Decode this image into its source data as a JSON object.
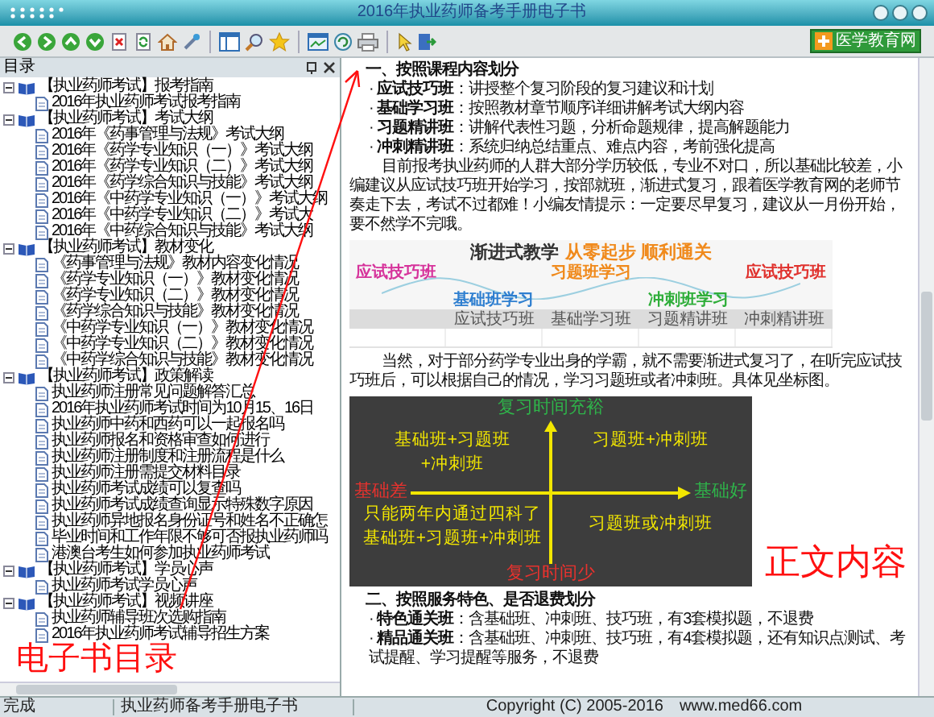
{
  "window": {
    "title": "2016年执业药师备考手册电子书"
  },
  "toolbar": {
    "logo": "医学教育网"
  },
  "sidebar": {
    "title": "目录",
    "tree": [
      {
        "label": "【执业药师考试】报考指南",
        "expanded": true,
        "children": [
          {
            "label": "2016年执业药师考试报考指南"
          }
        ]
      },
      {
        "label": "【执业药师考试】考试大纲",
        "expanded": true,
        "children": [
          {
            "label": "2016年《药事管理与法规》考试大纲"
          },
          {
            "label": "2016年《药学专业知识（一）》考试大纲"
          },
          {
            "label": "2016年《药学专业知识（二）》考试大纲"
          },
          {
            "label": "2016年《药学综合知识与技能》考试大纲"
          },
          {
            "label": "2016年《中药学专业知识（一）》考试大纲"
          },
          {
            "label": "2016年《中药学专业知识（二）》考试大"
          },
          {
            "label": "2016年《中药综合知识与技能》考试大纲"
          }
        ]
      },
      {
        "label": "【执业药师考试】教材变化",
        "expanded": true,
        "children": [
          {
            "label": "《药事管理与法规》教材内容变化情况"
          },
          {
            "label": "《药学专业知识（一）》教材变化情况"
          },
          {
            "label": "《药学专业知识（二）》教材变化情况"
          },
          {
            "label": "《药学综合知识与技能》教材变化情况"
          },
          {
            "label": "《中药学专业知识（一）》教材变化情况"
          },
          {
            "label": "《中药学专业知识（二）》教材变化情况"
          },
          {
            "label": "《中药学综合知识与技能》教材变化情况"
          }
        ]
      },
      {
        "label": "【执业药师考试】政策解读",
        "expanded": true,
        "children": [
          {
            "label": "执业药师注册常见问题解答汇总"
          },
          {
            "label": "2016年执业药师考试时间为10月15、16日"
          },
          {
            "label": "执业药师中药和西药可以一起报名吗"
          },
          {
            "label": "执业药师报名和资格审查如何进行"
          },
          {
            "label": "执业药师注册制度和注册流程是什么"
          },
          {
            "label": "执业药师注册需提交材料目录"
          },
          {
            "label": "执业药师考试成绩可以复查吗"
          },
          {
            "label": "执业药师考试成绩查询显示特殊数字原因"
          },
          {
            "label": "执业药师异地报名身份证号和姓名不正确怎"
          },
          {
            "label": "毕业时间和工作年限不够可否报执业药师吗"
          },
          {
            "label": "港澳台考生如何参加执业药师考试"
          }
        ]
      },
      {
        "label": "【执业药师考试】学员心声",
        "expanded": true,
        "children": [
          {
            "label": "执业药师考试学员心声"
          }
        ]
      },
      {
        "label": "【执业药师考试】视频讲座",
        "expanded": true,
        "children": [
          {
            "label": "执业药师辅导班次选购指南"
          },
          {
            "label": "2016年执业药师考试辅导招生方案"
          }
        ]
      }
    ],
    "annotation": "电子书目录"
  },
  "content": {
    "section_1": {
      "heading": "一、按照课程内容划分",
      "items": [
        "· **应试技巧班**：讲授整个复习阶段的复习建议和计划",
        "· **基础学习班**：按照教材章节顺序详细讲解考试大纲内容",
        "· **习题精讲班**：讲解代表性习题，分析命题规律，提高解题能力",
        "· **冲刺精讲班**：系统归纳总结重点、难点内容，考前强化提高"
      ]
    },
    "paragraph_1": "目前报考执业药师的人群大部分学历较低，专业不对口，所以基础比较差，小编建议从应试技巧班开始学习，按部就班，渐进式复习，跟着医学教育网的老师节奏走下去，考试不过都难！小编友情提示：一定要尽早复习，建议从一月份开始，要不然学不完哦。",
    "infographic": {
      "title": "渐进式教学",
      "tagline": "从零起步 顺利通关",
      "stages": [
        {
          "label": "应试技巧班",
          "color": "#d6339b"
        },
        {
          "label": "基础班学习",
          "color": "#2f7fd0"
        },
        {
          "label": "习题班学习",
          "color": "#f08a1c"
        },
        {
          "label": "冲刺班学习",
          "color": "#2fae3a"
        },
        {
          "label": "应试技巧班",
          "color": "#e0322e"
        }
      ],
      "table_headers": [
        "应试技巧班",
        "基础学习班",
        "习题精讲班",
        "冲刺精讲班"
      ]
    },
    "paragraph_2": "当然，对于部分药学专业出身的学霸，就不需要渐进式复习了，在听完应试技巧班后，可以根据自己的情况，学习习题班或者冲刺班。具体见坐标图。",
    "diagram": {
      "top": "复习时间充裕",
      "bottom": "复习时间少",
      "left": "基础差",
      "right": "基础好",
      "quadrants": [
        [
          "基础班+习题班",
          "+冲刺班"
        ],
        [
          "习题班+冲刺班"
        ],
        [
          "只能两年内通过四科了",
          "基础班+习题班+冲刺班"
        ],
        [
          "习题班或冲刺班"
        ]
      ]
    },
    "annotation": "正文内容",
    "section_2": {
      "heading": "二、按照服务特色、是否退费划分",
      "items": [
        "· **特色通关班**：含基础班、冲刺班、技巧班，有3套模拟题，不退费",
        "· **精品通关班**：含基础班、冲刺班、技巧班，有4套模拟题，还有知识点测试、考试提醒、学习提醒等服务，不退费"
      ]
    }
  },
  "status_bar": [
    "完成",
    "执业药师备考手册电子书",
    "Copyright (C) 2005-2016",
    "www.med66.com"
  ]
}
